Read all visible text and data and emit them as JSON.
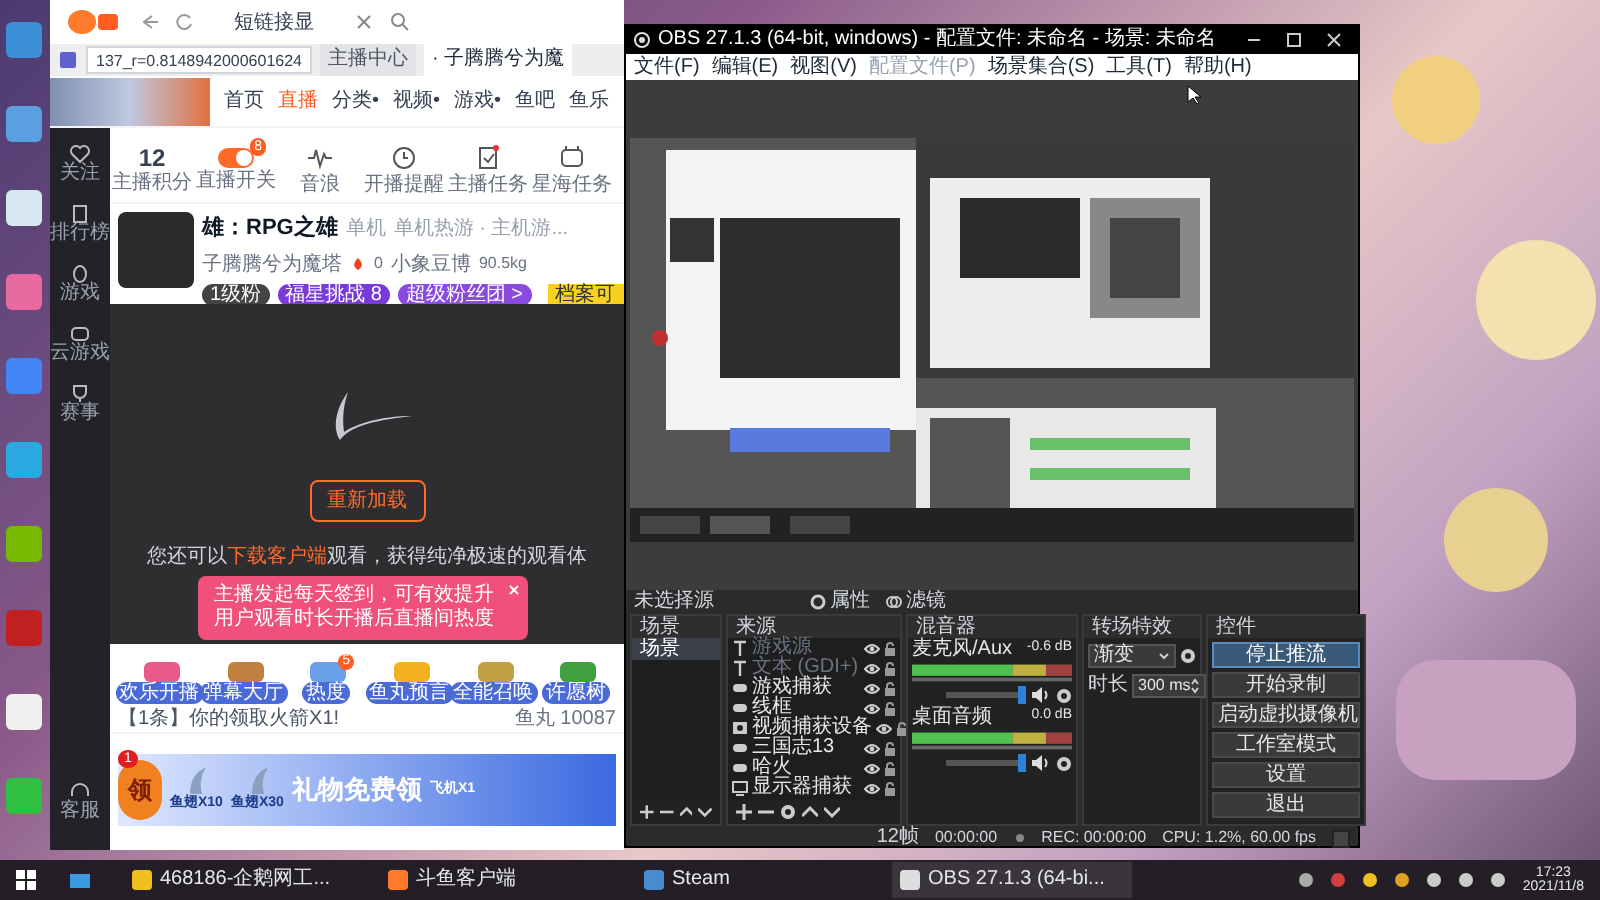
{
  "browser": {
    "top_bar": {
      "search_text": "短链接显"
    },
    "url": "137_r=0.8148942000601624",
    "tabs": [
      {
        "label": "主播中心",
        "selected": false
      },
      {
        "label": "· 子腾腾兮为魔",
        "selected": true
      }
    ],
    "nav": [
      {
        "label": "首页",
        "selected": false
      },
      {
        "label": "直播",
        "selected": true
      },
      {
        "label": "分类•",
        "selected": false
      },
      {
        "label": "视频•",
        "selected": false
      },
      {
        "label": "游戏•",
        "selected": false
      },
      {
        "label": "鱼吧",
        "selected": false
      },
      {
        "label": "鱼乐",
        "selected": false
      }
    ],
    "sidebar": [
      "关注",
      "排行榜",
      "游戏",
      "云游戏",
      "赛事",
      "客服"
    ],
    "stats": [
      {
        "kind": "score",
        "value": "12",
        "label": "主播积分"
      },
      {
        "kind": "toggle",
        "on": true,
        "badge": "8",
        "label": "直播开关"
      },
      {
        "kind": "wave",
        "label": "音浪"
      },
      {
        "kind": "clock",
        "label": "开播提醒"
      },
      {
        "kind": "task",
        "label": "主播任务"
      },
      {
        "kind": "ad",
        "label": "星海任务"
      }
    ],
    "room": {
      "title": "雄：RPG之雄",
      "category": "单机",
      "breadcrumb": "单机热游 · 主机游...",
      "anchor": "子腾腾兮为魔塔",
      "likes": "0",
      "club": "小象豆博",
      "weight": "90.5kg",
      "badges": [
        "1级粉",
        "福星挑战 8",
        "超级粉丝团 >"
      ],
      "archive": "档案可"
    },
    "player": {
      "reload": "重新加载",
      "hint_before": "您还可以",
      "hint_link": "下载客户端",
      "hint_after": "观看，获得纯净极速的观看体"
    },
    "tooltip": "主播发起每天签到，可有效提升用户观看时长开播后直播间热度",
    "gifts": [
      {
        "label": "欢乐开播"
      },
      {
        "label": "弹幕大厅"
      },
      {
        "label": "热度",
        "badge": "5"
      },
      {
        "label": "鱼丸预言"
      },
      {
        "label": "全能召唤"
      },
      {
        "label": "许愿树"
      }
    ],
    "notice": "【1条】你的领取火箭X1!",
    "fish_ball": "鱼丸 10087",
    "banner": {
      "claim": "领",
      "badge": "1",
      "items": [
        "鱼翅X10",
        "鱼翅X30"
      ],
      "title": "礼物免费领",
      "extra": "飞机X1"
    }
  },
  "obs": {
    "title": "OBS 27.1.3 (64-bit, windows) - 配置文件: 未命名 - 场景: 未命名",
    "menu": [
      {
        "label": "文件(F)",
        "disabled": false
      },
      {
        "label": "编辑(E)",
        "disabled": false
      },
      {
        "label": "视图(V)",
        "disabled": false
      },
      {
        "label": "配置文件(P)",
        "disabled": true
      },
      {
        "label": "场景集合(S)",
        "disabled": false
      },
      {
        "label": "工具(T)",
        "disabled": false
      },
      {
        "label": "帮助(H)",
        "disabled": false
      }
    ],
    "source_bar": {
      "label": "未选择源",
      "buttons": [
        "属性",
        "滤镜"
      ]
    },
    "docks": {
      "scenes": "场景",
      "sources": "来源",
      "mixer": "混音器",
      "transitions": "转场特效",
      "controls": "控件"
    },
    "scenes": [
      {
        "name": "场景",
        "selected": true
      }
    ],
    "sources": [
      {
        "kind": "text",
        "name": "游戏源",
        "disabled": true,
        "visible": true
      },
      {
        "kind": "text",
        "name": "文本 (GDI+)",
        "disabled": true,
        "visible": true
      },
      {
        "kind": "game",
        "name": "游戏捕获",
        "disabled": false,
        "visible": true
      },
      {
        "kind": "game",
        "name": "线框",
        "disabled": false,
        "visible": true
      },
      {
        "kind": "camera",
        "name": "视频捕获设备",
        "disabled": false,
        "visible": true
      },
      {
        "kind": "game",
        "name": "三国志13",
        "disabled": false,
        "visible": true
      },
      {
        "kind": "game",
        "name": "哈火",
        "disabled": false,
        "visible": true
      },
      {
        "kind": "display",
        "name": "显示器捕获",
        "disabled": false,
        "visible": true
      }
    ],
    "mixer": [
      {
        "name": "麦克风/Aux",
        "reading": "-0.6 dB",
        "level": 1
      },
      {
        "name": "桌面音频",
        "reading": "0.0 dB",
        "level": 1
      }
    ],
    "transition": {
      "value": "渐变",
      "duration_label": "时长",
      "duration": "300 ms"
    },
    "controls": [
      {
        "label": "停止推流",
        "active": true
      },
      {
        "label": "开始录制",
        "active": false
      },
      {
        "label": "启动虚拟摄像机",
        "active": false
      },
      {
        "label": "工作室模式",
        "active": false
      },
      {
        "label": "设置",
        "active": false
      },
      {
        "label": "退出",
        "active": false
      }
    ],
    "status_bar": {
      "dropped": "12帧",
      "live": "00:00:00",
      "rec": "REC: 00:00:00",
      "cpu": "CPU: 1.2%, 60.00 fps"
    }
  },
  "taskbar": {
    "apps": [
      "468186-企鹅网工...",
      "斗鱼客户端",
      "Steam",
      "OBS 27.1.3 (64-bi..."
    ],
    "time": "17:23",
    "date": "2021/11/8"
  }
}
